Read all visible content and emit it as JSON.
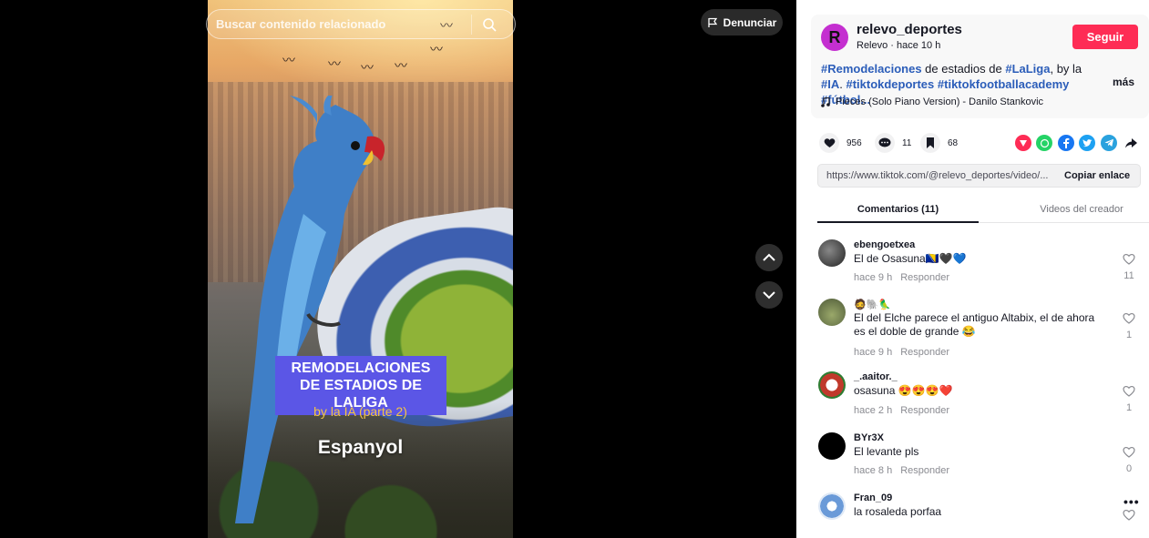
{
  "search": {
    "placeholder": "Buscar contenido relacionado"
  },
  "report": {
    "label": "Denunciar"
  },
  "video": {
    "title": "REMODELACIONES DE ESTADIOS DE LALIGA",
    "subtitle": "by la IA (parte 2)",
    "team": "Espanyol"
  },
  "author": {
    "username": "relevo_deportes",
    "meta": "Relevo · hace 10 h",
    "follow_label": "Seguir",
    "avatar_glyph": "R"
  },
  "caption": {
    "parts": [
      "#Remodelaciones",
      " de estadios de ",
      "#LaLiga",
      ", by la ",
      "#IA",
      ". ",
      "#tiktokdeportes",
      " ",
      "#tiktokfootballacademy",
      " ",
      "#fútbol..."
    ],
    "more_label": "más"
  },
  "music": {
    "title": "Pieces (Solo Piano Version) - Danilo Stankovic"
  },
  "stats": {
    "likes": "956",
    "comments": "11",
    "saves": "68"
  },
  "link": {
    "url": "https://www.tiktok.com/@relevo_deportes/video/...",
    "copy_label": "Copiar enlace"
  },
  "tabs": {
    "comments": "Comentarios (11)",
    "videos": "Videos del creador"
  },
  "comments": [
    {
      "user": "ebengoetxea",
      "text": "El de Osasuna🇧🇦🖤💙",
      "time": "hace 9 h",
      "reply": "Responder",
      "likes": "11",
      "avatar_color": "#2a2a2a"
    },
    {
      "user": "🧔🐘🦜",
      "text": "El del Elche parece el antiguo Altabix, el de ahora es el doble de grande 😂",
      "time": "hace 9 h",
      "reply": "Responder",
      "likes": "1",
      "avatar_color": "#7a8a5a"
    },
    {
      "user": "_.aaitor._",
      "text": "osasuna 😍😍😍❤️",
      "time": "hace 2 h",
      "reply": "Responder",
      "likes": "1",
      "avatar_color": "#c0392b"
    },
    {
      "user": "BYr3X",
      "text": "El levante pls",
      "time": "hace 8 h",
      "reply": "Responder",
      "likes": "0",
      "avatar_color": "#000000"
    },
    {
      "user": "Fran_09",
      "text": "la rosaleda porfaa",
      "time": "",
      "reply": "",
      "likes": "",
      "avatar_color": "#6a9ad8"
    }
  ],
  "more_options_glyph": "•••"
}
